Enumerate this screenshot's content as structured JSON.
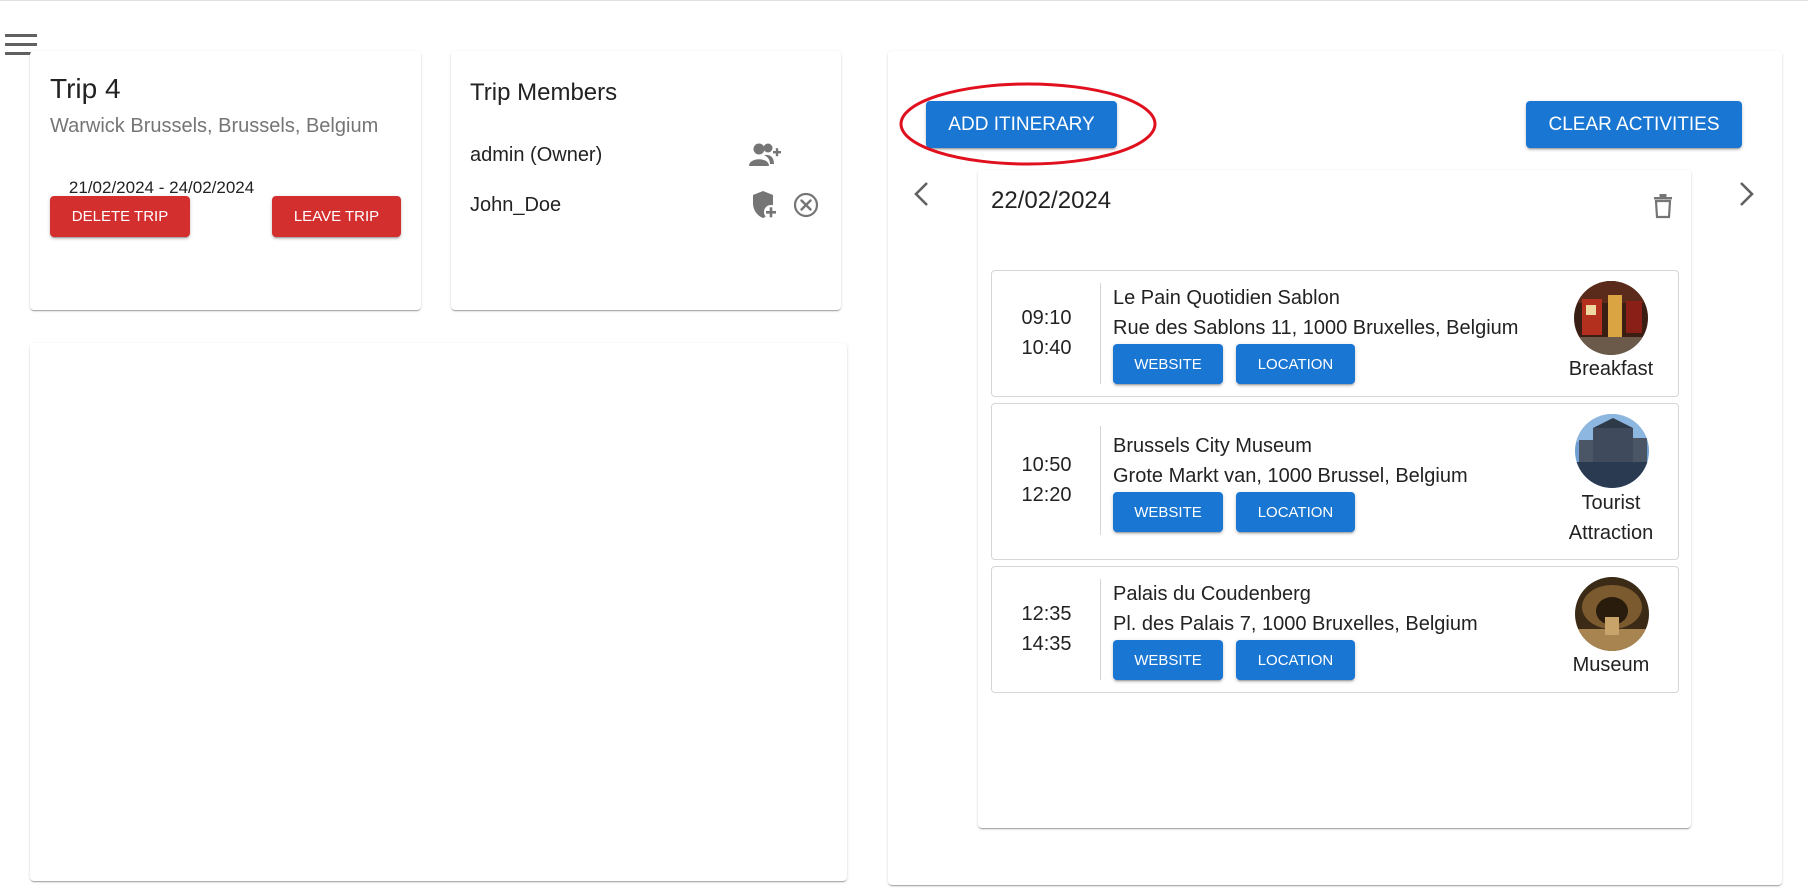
{
  "menu": {
    "icon": "hamburger-menu-icon"
  },
  "trip": {
    "title": "Trip 4",
    "location": "Warwick Brussels, Brussels, Belgium",
    "start_date": "21/02/2024",
    "date_separator": " - ",
    "end_date": "24/02/2024",
    "delete_label": "DELETE TRIP",
    "leave_label": "LEAVE TRIP"
  },
  "members": {
    "title": "Trip Members",
    "list": [
      {
        "name": "admin (Owner)",
        "icons": [
          "add-member-icon"
        ]
      },
      {
        "name": "John_Doe",
        "icons": [
          "add-admin-shield-icon",
          "remove-member-icon"
        ]
      }
    ]
  },
  "itinerary": {
    "add_label": "ADD ITINERARY",
    "clear_label": "CLEAR ACTIVITIES",
    "date": "22/02/2024",
    "activities": [
      {
        "start": "09:10",
        "end": "10:40",
        "name": "Le Pain Quotidien Sablon",
        "address": "Rue des Sablons 11, 1000 Bruxelles, Belgium",
        "website_label": "WEBSITE",
        "location_label": "LOCATION",
        "category": "Breakfast"
      },
      {
        "start": "10:50",
        "end": "12:20",
        "name": "Brussels City Museum",
        "address": "Grote Markt van, 1000 Brussel, Belgium",
        "website_label": "WEBSITE",
        "location_label": "LOCATION",
        "category_line1": "Tourist",
        "category_line2": "Attraction"
      },
      {
        "start": "12:35",
        "end": "14:35",
        "name": "Palais du Coudenberg",
        "address": "Pl. des Palais 7, 1000 Bruxelles, Belgium",
        "website_label": "WEBSITE",
        "location_label": "LOCATION",
        "category": "Museum"
      }
    ]
  },
  "colors": {
    "primary": "#1976d2",
    "error": "#d32f2f",
    "highlight_ring": "#e0101e"
  }
}
